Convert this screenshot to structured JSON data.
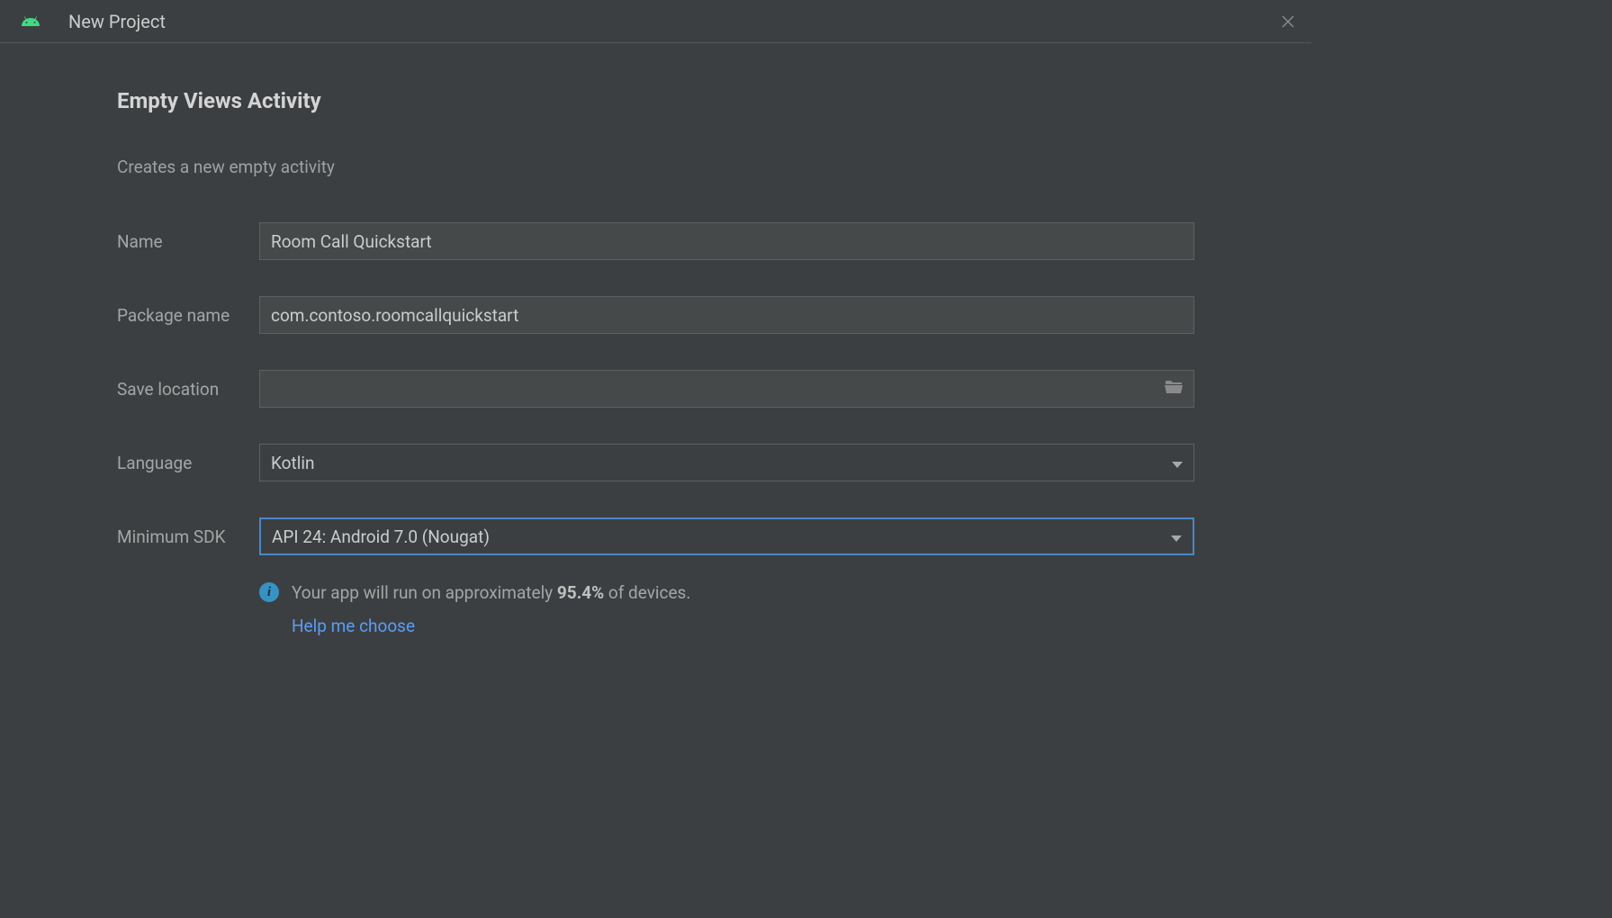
{
  "window": {
    "title": "New Project"
  },
  "page": {
    "heading": "Empty Views Activity",
    "description": "Creates a new empty activity"
  },
  "form": {
    "name": {
      "label": "Name",
      "value": "Room Call Quickstart"
    },
    "package_name": {
      "label": "Package name",
      "value": "com.contoso.roomcallquickstart"
    },
    "save_location": {
      "label": "Save location",
      "value": ""
    },
    "language": {
      "label": "Language",
      "value": "Kotlin"
    },
    "minimum_sdk": {
      "label": "Minimum SDK",
      "value": "API 24: Android 7.0 (Nougat)"
    }
  },
  "info": {
    "text_prefix": "Your app will run on approximately ",
    "percentage": "95.4%",
    "text_suffix": " of devices.",
    "help_link": "Help me choose"
  }
}
